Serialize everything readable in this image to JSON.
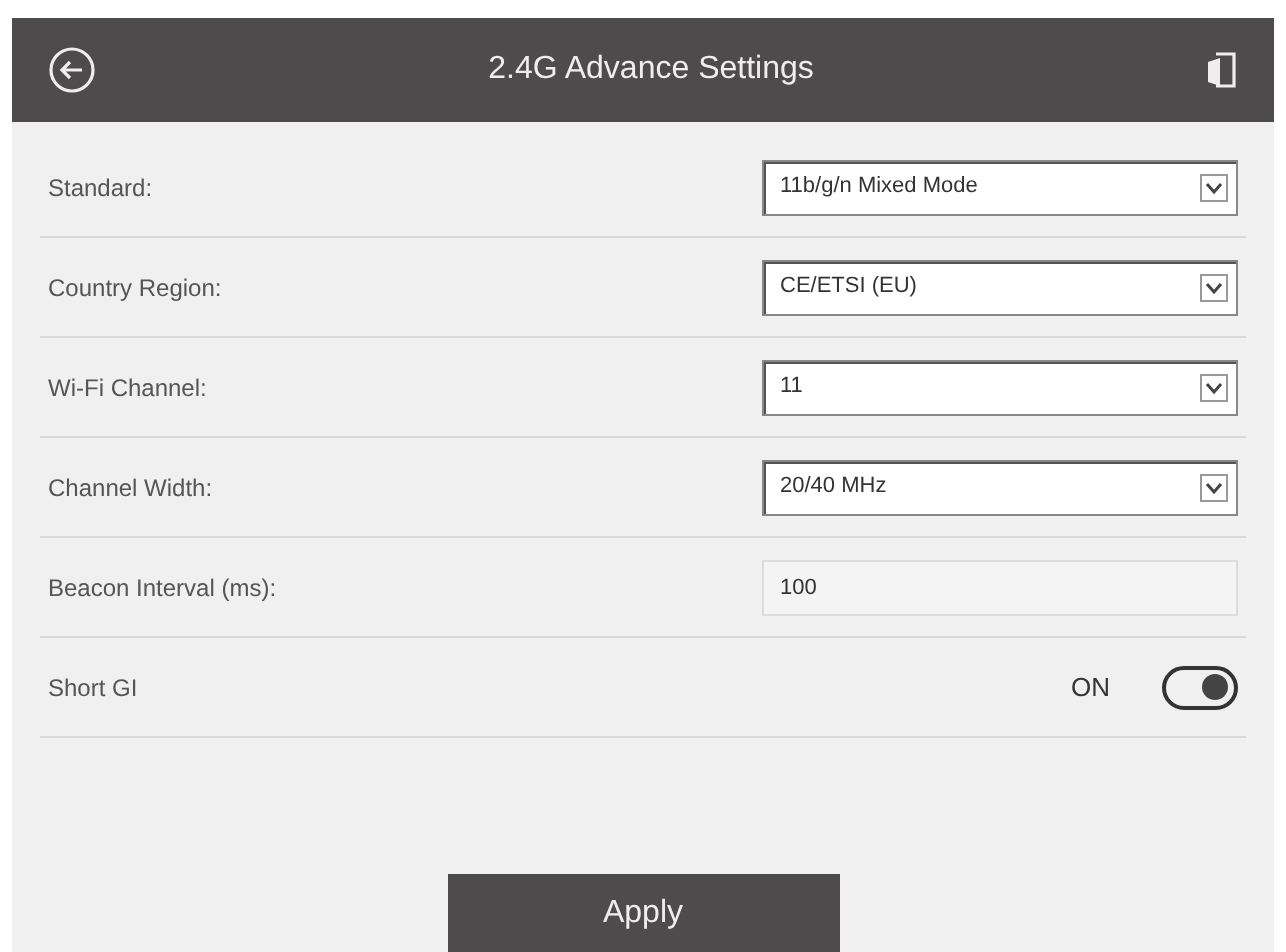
{
  "header": {
    "title": "2.4G Advance Settings"
  },
  "settings": [
    {
      "kind": "select",
      "label": "Standard:",
      "value": "11b/g/n Mixed Mode"
    },
    {
      "kind": "select",
      "label": "Country Region:",
      "value": "CE/ETSI (EU)"
    },
    {
      "kind": "select",
      "label": "Wi-Fi Channel:",
      "value": "11"
    },
    {
      "kind": "select",
      "label": "Channel Width:",
      "value": "20/40 MHz"
    },
    {
      "kind": "text",
      "label": "Beacon Interval (ms):",
      "value": "100"
    },
    {
      "kind": "toggle",
      "label": "Short GI",
      "state_text": "ON",
      "on": true
    }
  ],
  "apply_button": "Apply"
}
